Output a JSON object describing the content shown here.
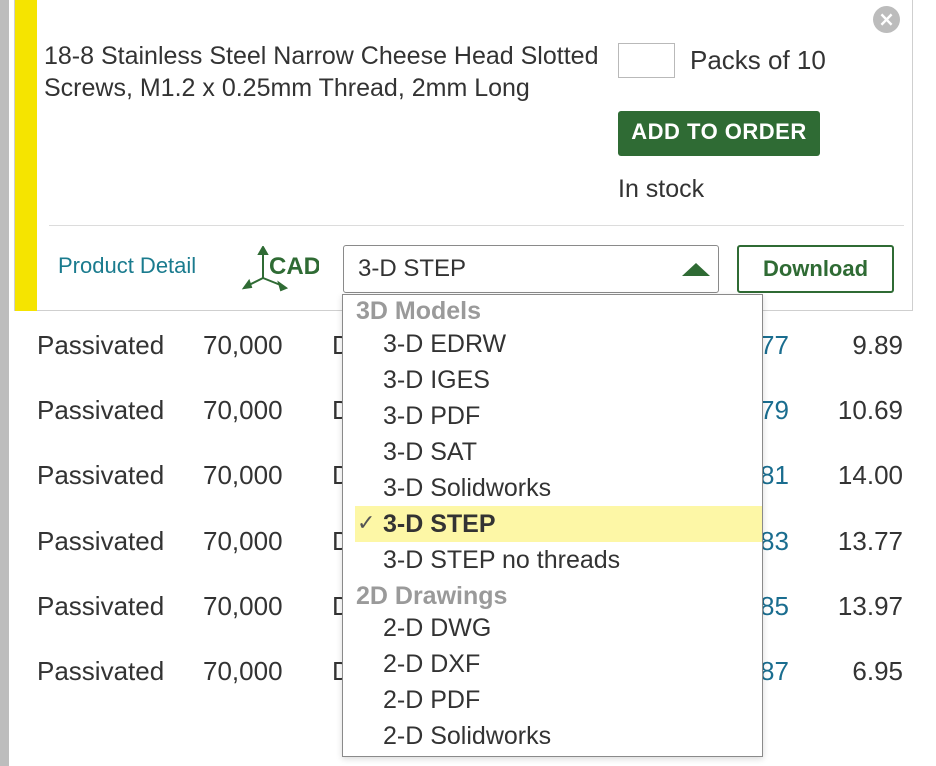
{
  "table": {
    "rows": [
      {
        "finish": "Passivated",
        "strength": "70,000",
        "col3": "D",
        "part": "77",
        "price": "9.89"
      },
      {
        "finish": "Passivated",
        "strength": "70,000",
        "col3": "D",
        "part": "79",
        "price": "10.69"
      },
      {
        "finish": "Passivated",
        "strength": "70,000",
        "col3": "D",
        "part": "81",
        "price": "14.00"
      },
      {
        "finish": "Passivated",
        "strength": "70,000",
        "col3": "D",
        "part": "83",
        "price": "13.77"
      },
      {
        "finish": "Passivated",
        "strength": "70,000",
        "col3": "D",
        "part": "85",
        "price": "13.97"
      },
      {
        "finish": "Passivated",
        "strength": "70,000",
        "col3": "D",
        "part": "87",
        "price": "6.95"
      }
    ]
  },
  "card": {
    "title": "18-8 Stainless Steel Narrow Cheese Head Slotted Screws, M1.2 x 0.25mm Thread, 2mm Long",
    "close_icon": "×",
    "quantity_value": "",
    "packs_label": "Packs of 10",
    "add_to_order_label": "ADD TO ORDER",
    "stock_status": "In stock",
    "product_detail_label": "Product Detail",
    "cad_logo_text": "CAD",
    "selected_format": "3-D STEP",
    "download_label": "Download",
    "accent_color": "#f5e400",
    "brand_green": "#2f6b34"
  },
  "dropdown": {
    "groups": [
      {
        "label": "3D Models",
        "options": [
          "3-D EDRW",
          "3-D IGES",
          "3-D PDF",
          "3-D SAT",
          "3-D Solidworks",
          "3-D STEP",
          "3-D STEP no threads"
        ]
      },
      {
        "label": "2D Drawings",
        "options": [
          "2-D DWG",
          "2-D DXF",
          "2-D PDF",
          "2-D Solidworks"
        ]
      }
    ],
    "check_icon": "✓",
    "highlight_color": "#fdf7a6"
  }
}
